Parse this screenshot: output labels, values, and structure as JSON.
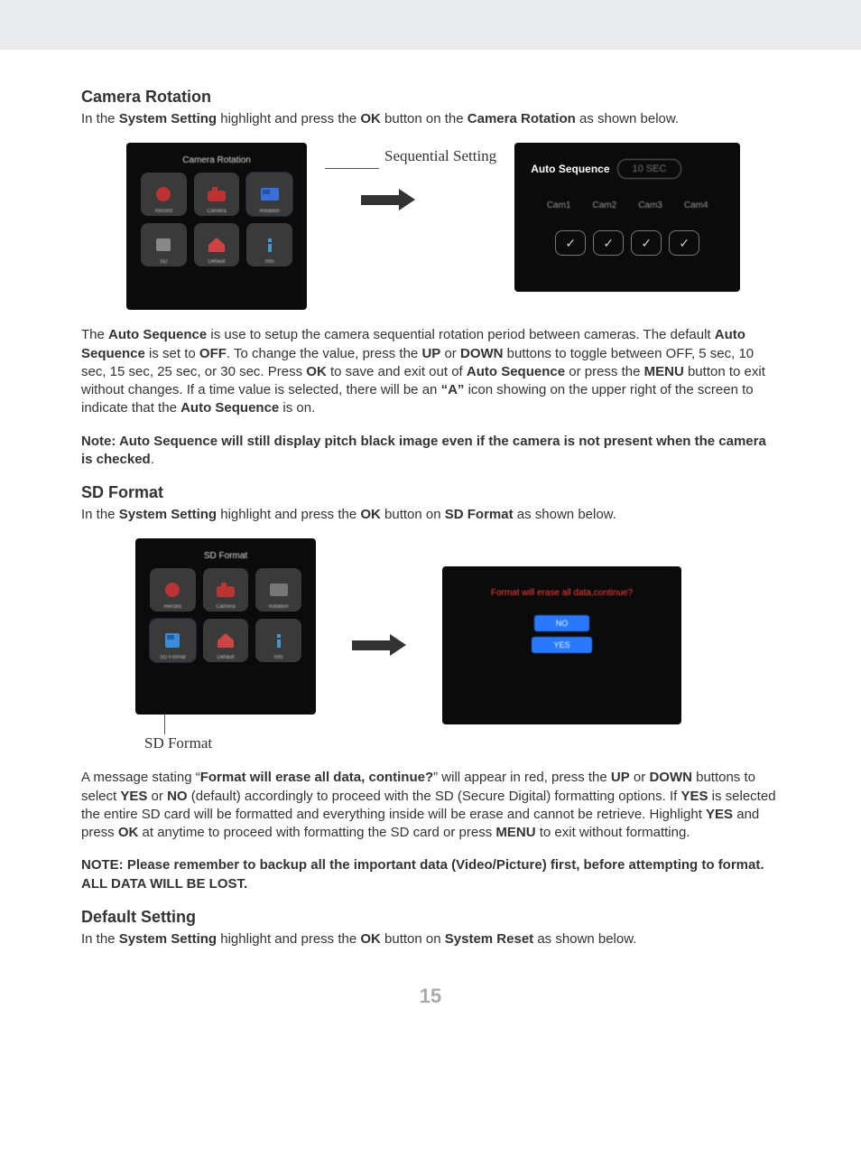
{
  "page_number": "15",
  "sections": {
    "camera_rotation": {
      "heading": "Camera Rotation",
      "intro_pre": "In the ",
      "b1": "System Setting",
      "mid1": " highlight and press the ",
      "b2": "OK",
      "mid2": " button on the ",
      "b3": "Camera Rotation",
      "tail": " as shown below.",
      "fig_caption_right": "Sequential Setting",
      "dev1_title": "Camera Rotation",
      "auto_sequence_label": "Auto Sequence",
      "auto_sequence_value": "10 SEC",
      "cam_labels": [
        "Cam1",
        "Cam2",
        "Cam3",
        "Cam4"
      ],
      "para2_parts": {
        "t1": "The ",
        "b1": "Auto Sequence",
        "t2": " is use to setup the camera sequential rotation period between cameras.  The default ",
        "b2": "Auto Sequence",
        "t3": " is set to ",
        "b3": "OFF",
        "t4": ". To change the value, press the ",
        "b4": "UP",
        "t5": " or ",
        "b5": "DOWN",
        "t6": " buttons to toggle between OFF, 5 sec, 10 sec, 15 sec, 25 sec, or 30 sec.  Press ",
        "b6": "OK",
        "t7": " to save and exit out of ",
        "b7": "Auto Sequence",
        "t8": " or press the ",
        "b8": "MENU",
        "t9": " button to exit without changes.  If a time value is selected, there will be an ",
        "b9": "“A”",
        "t10": " icon showing on the upper right of the screen to indicate that the ",
        "b10": "Auto Sequence",
        "t11": " is on."
      },
      "note": "Note: Auto Sequence will still display pitch black image even if the camera is not present when the camera is checked",
      "note_tail": "."
    },
    "sd_format": {
      "heading": "SD Format",
      "intro_pre": "In the ",
      "b1": "System Setting",
      "mid1": " highlight and press the ",
      "b2": "OK",
      "mid2": " button on ",
      "b3": "SD Format",
      "tail": " as shown below.",
      "dev_title": "SD Format",
      "dialog_text": "Format will erase all data,continue?",
      "btn_no": "NO",
      "btn_yes": "YES",
      "sd_caption": "SD Format",
      "para2_parts": {
        "t1": "A message stating “",
        "b1": "Format will erase all data, continue?",
        "t2": "” will appear in red, press the ",
        "b2": "UP",
        "t3": " or ",
        "b3": "DOWN",
        "t4": " buttons to select ",
        "b4": "YES",
        "t5": " or ",
        "b5": "NO",
        "t6": " (default) accordingly to proceed with the SD (Secure Digital) formatting options. If ",
        "b6": "YES",
        "t7": " is selected the entire SD card will be formatted and everything inside will be erase and cannot be retrieve.  Highlight ",
        "b7": "YES",
        "t8": " and press ",
        "b8": "OK",
        "t9": " at anytime to proceed with formatting the SD card or press ",
        "b9": "MENU",
        "t10": " to exit without formatting."
      },
      "note": "NOTE: Please remember to backup all the important data (Video/Picture) first, before attempting to format.  ALL DATA WILL BE LOST."
    },
    "default_setting": {
      "heading": "Default Setting",
      "intro_pre": "In the ",
      "b1": "System Setting",
      "mid1": " highlight and press the ",
      "b2": "OK",
      "mid2": " button on ",
      "b3": "System Reset",
      "tail": " as shown below."
    }
  }
}
